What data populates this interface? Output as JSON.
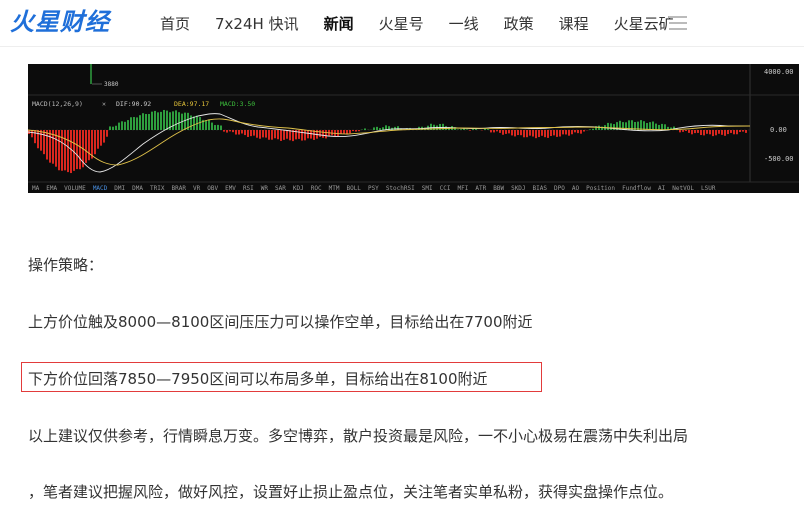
{
  "header": {
    "logo_text": "火星财经",
    "nav": [
      {
        "label": "首页",
        "active": false
      },
      {
        "label": "7x24H 快讯",
        "active": false
      },
      {
        "label": "新闻",
        "active": true
      },
      {
        "label": "火星号",
        "active": false
      },
      {
        "label": "一线",
        "active": false
      },
      {
        "label": "政策",
        "active": false
      },
      {
        "label": "课程",
        "active": false
      },
      {
        "label": "火星云矿",
        "active": false
      }
    ],
    "menu_icon": "hamburger-menu-icon"
  },
  "chart": {
    "price_label": "3880",
    "price_axis_label": "4000.00",
    "indicator_legend": {
      "name": "MACD(12,26,9)",
      "dif": "DIF:90.92",
      "dea": "DEA:97.17",
      "macd": "MACD:3.50"
    },
    "macd_axis": [
      "0.00",
      "-500.00"
    ],
    "indicator_tabs": [
      "MA",
      "EMA",
      "VOLUME",
      "MACD",
      "DMI",
      "DMA",
      "TRIX",
      "BRAR",
      "VR",
      "OBV",
      "EMV",
      "RSI",
      "WR",
      "SAR",
      "KDJ",
      "ROC",
      "MTM",
      "BOLL",
      "PSY",
      "StochRSI",
      "SMI",
      "CCI",
      "MFI",
      "ATR",
      "BBW",
      "SKDJ",
      "BIAS",
      "DPO",
      "AO",
      "Position",
      "Fundflow",
      "AI",
      "NetVOL",
      "LSUR"
    ],
    "active_tab": "MACD",
    "colors": {
      "up": "#2e9e3e",
      "down": "#d9271f",
      "dif": "#e8e8e8",
      "dea": "#e0c24a",
      "macd_label": "#3cbf3c",
      "dif_label": "#cccccc",
      "dea_label": "#e6c53a",
      "active_tab": "#4a8fe0"
    }
  },
  "article": {
    "p1": "操作策略：",
    "p2": "上方价位触及8000—8100区间压压力可以操作空单，目标给出在7700附近",
    "p3": "下方价位回落7850—7950区间可以布局多单，目标给出在8100附近",
    "p4": "以上建议仅供参考，行情瞬息万变。多空博弈，散户投资最是风险，一不小心极易在震荡中失利出局",
    "p5": "，笔者建议把握风险，做好风控，设置好止损止盈点位，关注笔者实单私粉，获得实盘操作点位。"
  }
}
